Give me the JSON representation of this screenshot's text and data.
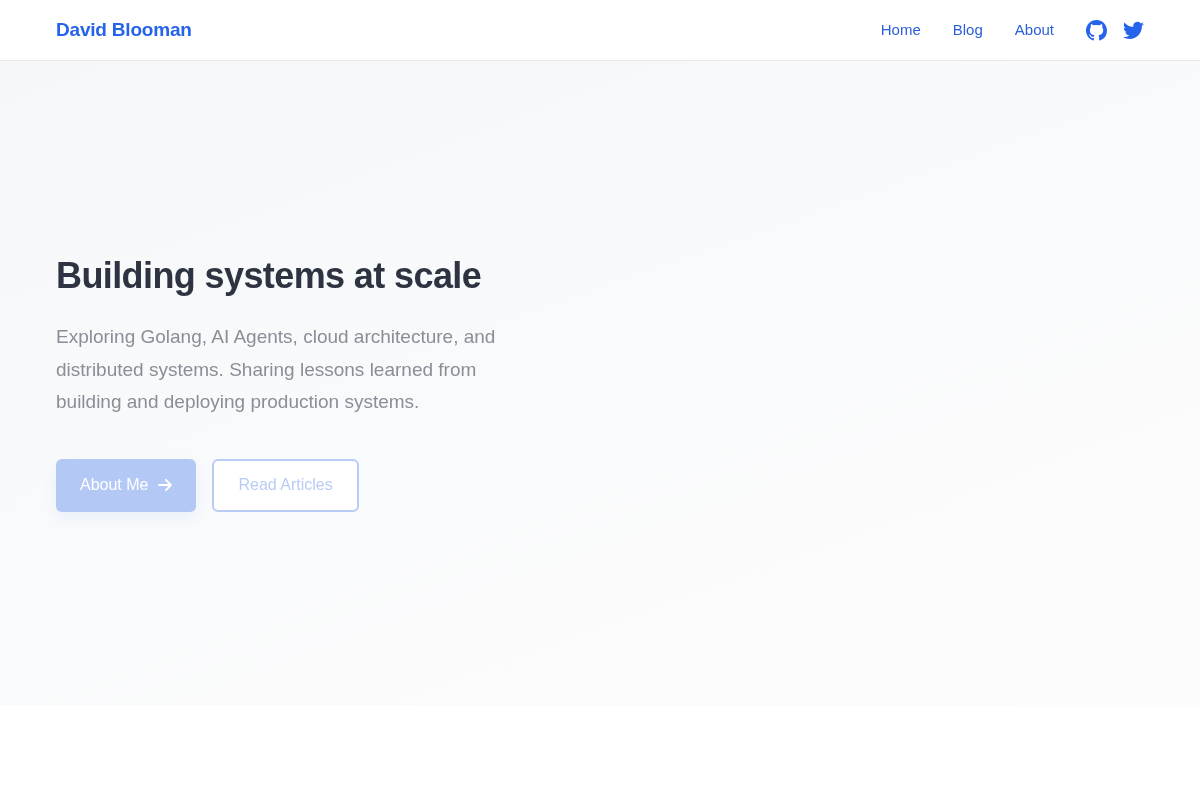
{
  "navbar": {
    "brand": "David Blooman",
    "links": [
      {
        "label": "Home"
      },
      {
        "label": "Blog"
      },
      {
        "label": "About"
      }
    ]
  },
  "hero": {
    "title": "Building systems at scale",
    "text": "Exploring Golang, AI Agents, cloud architecture, and distributed systems. Sharing lessons learned from building and deploying production systems.",
    "buttons": [
      {
        "label": "About Me",
        "kind": "primary"
      },
      {
        "label": "Read Articles",
        "kind": "outline"
      }
    ]
  }
}
